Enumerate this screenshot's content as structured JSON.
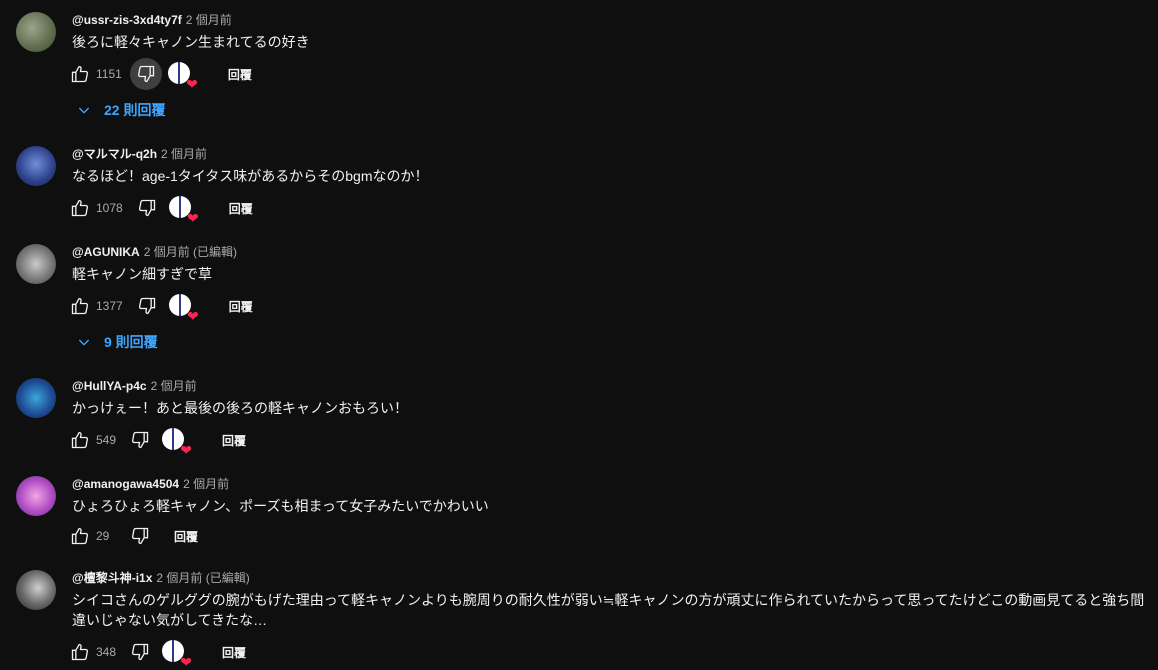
{
  "comments": [
    {
      "author": "@ussr-zis-3xd4ty7f",
      "time": "2 個月前",
      "text": "後ろに軽々キャノン生まれてるの好き",
      "likes": "1151",
      "reply_label": "回覆",
      "creator_heart": true,
      "replies": "22 則回覆"
    },
    {
      "author": "@マルマル-q2h",
      "time": "2 個月前",
      "text": "なるほど！age-1タイタス味があるからそのbgmなのか！",
      "likes": "1078",
      "reply_label": "回覆",
      "creator_heart": true
    },
    {
      "author": "@AGUNIKA",
      "time": "2 個月前 (已編輯)",
      "text": "軽キャノン細すぎで草",
      "likes": "1377",
      "reply_label": "回覆",
      "creator_heart": true,
      "replies": "9 則回覆"
    },
    {
      "author": "@HullYA-p4c",
      "time": "2 個月前",
      "text": "かっけぇー！あと最後の後ろの軽キャノンおもろい！",
      "likes": "549",
      "reply_label": "回覆",
      "creator_heart": true
    },
    {
      "author": "@amanogawa4504",
      "time": "2 個月前",
      "text": "ひょろひょろ軽キャノン、ポーズも相まって女子みたいでかわいい",
      "likes": "29",
      "reply_label": "回覆",
      "creator_heart": false
    },
    {
      "author": "@檀黎斗神-i1x",
      "time": "2 個月前 (已編輯)",
      "text": "シイコさんのゲルググの腕がもげた理由って軽キャノンよりも腕周りの耐久性が弱い≒軽キャノンの方が頑丈に作られていたからって思ってたけどこの動画見てると強ち間違いじゃない気がしてきたな…",
      "likes": "348",
      "reply_label": "回覆",
      "creator_heart": true
    }
  ],
  "colors": {
    "background": "#0f0f0f",
    "link": "#3ea6ff",
    "heart": "#ff2450"
  }
}
